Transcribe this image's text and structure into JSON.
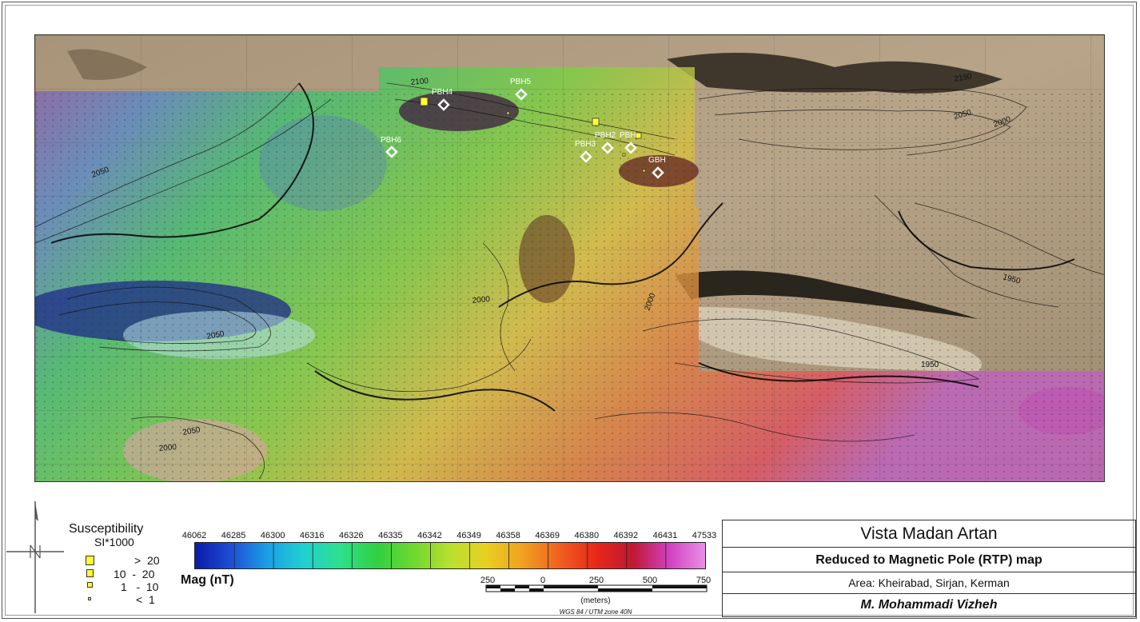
{
  "map": {
    "boreholes": [
      {
        "label": "PBH4"
      },
      {
        "label": "PBH5"
      },
      {
        "label": "PBH6"
      },
      {
        "label": "PBH3"
      },
      {
        "label": "PBH2"
      },
      {
        "label": "PBH"
      },
      {
        "label": "GBH"
      }
    ],
    "contour_labels": [
      "2100",
      "2150",
      "2050",
      "2000",
      "2050",
      "2000",
      "2050",
      "2000",
      "1950",
      "1950",
      "2050",
      "2000"
    ]
  },
  "susceptibility": {
    "title": "Susceptibility",
    "subtitle": "SI*1000",
    "classes": [
      {
        "label": ">  20"
      },
      {
        "label": "10  -  20"
      },
      {
        "label": "1   -  10"
      },
      {
        "label": "<  1"
      }
    ]
  },
  "colorbar": {
    "label": "Mag (nT)",
    "ticks": [
      "46062",
      "46285",
      "46300",
      "46316",
      "46326",
      "46335",
      "46342",
      "46349",
      "46358",
      "46369",
      "46380",
      "46392",
      "46431",
      "47533"
    ],
    "colors": [
      "#0a1aa8",
      "#1f4fd6",
      "#1aa0e6",
      "#20d0d0",
      "#2ee08a",
      "#30d040",
      "#70d830",
      "#b8e030",
      "#e8d020",
      "#f0a020",
      "#f06020",
      "#e82818",
      "#c01830",
      "#d040c0",
      "#e890e8"
    ]
  },
  "scalebar": {
    "ticks": [
      "250",
      "0",
      "250",
      "500",
      "750"
    ],
    "unit": "(meters)",
    "projection": "WGS 84 / UTM zone 40N"
  },
  "title_block": {
    "company": "Vista Madan Artan",
    "map_title": "Reduced to Magnetic Pole (RTP) map",
    "area": "Area: Kheirabad, Sirjan, Kerman",
    "author": "M. Mohammadi Vizheh"
  }
}
